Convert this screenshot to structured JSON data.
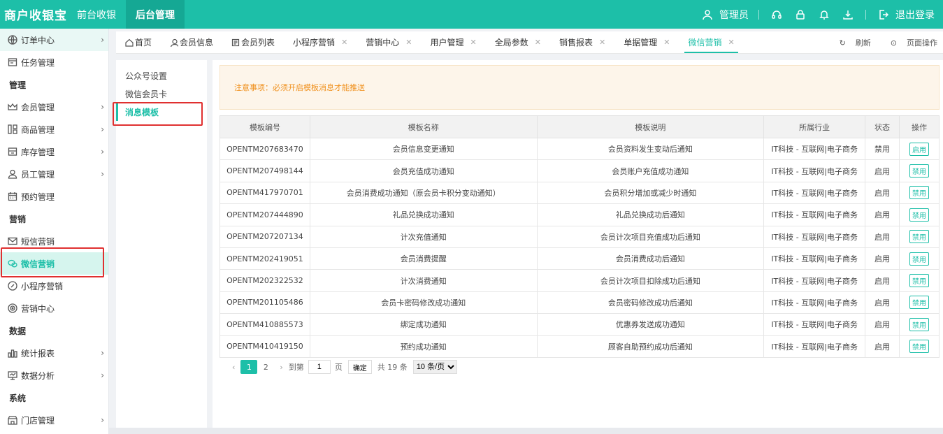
{
  "app": {
    "logo": "商户收银宝",
    "nav": [
      {
        "label": "前台收银",
        "active": false
      },
      {
        "label": "后台管理",
        "active": true
      }
    ],
    "user": "管理员",
    "logout": "退出登录"
  },
  "sidebar": {
    "items": [
      {
        "type": "item",
        "label": "订单中心",
        "icon": "globe-icon",
        "chevron": true,
        "state": "first"
      },
      {
        "type": "item",
        "label": "任务管理",
        "icon": "task-icon",
        "chevron": false
      },
      {
        "type": "group",
        "label": "管理"
      },
      {
        "type": "item",
        "label": "会员管理",
        "icon": "crown-icon",
        "chevron": true
      },
      {
        "type": "item",
        "label": "商品管理",
        "icon": "grid-icon",
        "chevron": true
      },
      {
        "type": "item",
        "label": "库存管理",
        "icon": "box-icon",
        "chevron": true
      },
      {
        "type": "item",
        "label": "员工管理",
        "icon": "user-icon",
        "chevron": true
      },
      {
        "type": "item",
        "label": "预约管理",
        "icon": "calendar-icon",
        "chevron": false
      },
      {
        "type": "group",
        "label": "营销"
      },
      {
        "type": "item",
        "label": "短信营销",
        "icon": "mail-icon",
        "chevron": false
      },
      {
        "type": "item",
        "label": "微信营销",
        "icon": "wechat-icon",
        "chevron": false,
        "state": "active"
      },
      {
        "type": "item",
        "label": "小程序营销",
        "icon": "link-icon",
        "chevron": false
      },
      {
        "type": "item",
        "label": "营销中心",
        "icon": "target-icon",
        "chevron": false
      },
      {
        "type": "group",
        "label": "数据"
      },
      {
        "type": "item",
        "label": "统计报表",
        "icon": "chart-icon",
        "chevron": true
      },
      {
        "type": "item",
        "label": "数据分析",
        "icon": "monitor-icon",
        "chevron": true
      },
      {
        "type": "group",
        "label": "系统"
      },
      {
        "type": "item",
        "label": "门店管理",
        "icon": "store-icon",
        "chevron": true
      }
    ]
  },
  "tabs": {
    "items": [
      {
        "label": "首页",
        "icon": "home-icon",
        "closable": false
      },
      {
        "label": "会员信息",
        "icon": "user-icon",
        "closable": false
      },
      {
        "label": "会员列表",
        "icon": "list-icon",
        "closable": false
      },
      {
        "label": "小程序营销",
        "closable": true
      },
      {
        "label": "营销中心",
        "closable": true
      },
      {
        "label": "用户管理",
        "closable": true
      },
      {
        "label": "全局参数",
        "closable": true
      },
      {
        "label": "销售报表",
        "closable": true
      },
      {
        "label": "单据管理",
        "closable": true
      },
      {
        "label": "微信营销",
        "closable": true,
        "active": true
      }
    ],
    "refresh": "刷新",
    "page_ops": "页面操作",
    "close_glyph": "✕"
  },
  "submenu": {
    "items": [
      {
        "label": "公众号设置"
      },
      {
        "label": "微信会员卡"
      },
      {
        "label": "消息模板",
        "active": true
      }
    ]
  },
  "notice": "注意事项：必须开启模板消息才能推送",
  "table": {
    "headers": [
      "模板编号",
      "模板名称",
      "模板说明",
      "所属行业",
      "状态",
      "操作"
    ],
    "rows": [
      {
        "code": "OPENTM207683470",
        "name": "会员信息变更通知",
        "desc": "会员资料发生变动后通知",
        "industry": "IT科技 - 互联网|电子商务",
        "status": "禁用",
        "action": "启用"
      },
      {
        "code": "OPENTM207498144",
        "name": "会员充值成功通知",
        "desc": "会员账户充值成功通知",
        "industry": "IT科技 - 互联网|电子商务",
        "status": "启用",
        "action": "禁用"
      },
      {
        "code": "OPENTM417970701",
        "name": "会员消费成功通知（原会员卡积分变动通知）",
        "desc": "会员积分增加或减少时通知",
        "industry": "IT科技 - 互联网|电子商务",
        "status": "启用",
        "action": "禁用"
      },
      {
        "code": "OPENTM207444890",
        "name": "礼品兑换成功通知",
        "desc": "礼品兑换成功后通知",
        "industry": "IT科技 - 互联网|电子商务",
        "status": "启用",
        "action": "禁用"
      },
      {
        "code": "OPENTM207207134",
        "name": "计次充值通知",
        "desc": "会员计次项目充值成功后通知",
        "industry": "IT科技 - 互联网|电子商务",
        "status": "启用",
        "action": "禁用"
      },
      {
        "code": "OPENTM202419051",
        "name": "会员消费提醒",
        "desc": "会员消费成功后通知",
        "industry": "IT科技 - 互联网|电子商务",
        "status": "启用",
        "action": "禁用"
      },
      {
        "code": "OPENTM202322532",
        "name": "计次消费通知",
        "desc": "会员计次项目扣除成功后通知",
        "industry": "IT科技 - 互联网|电子商务",
        "status": "启用",
        "action": "禁用"
      },
      {
        "code": "OPENTM201105486",
        "name": "会员卡密码修改成功通知",
        "desc": "会员密码修改成功后通知",
        "industry": "IT科技 - 互联网|电子商务",
        "status": "启用",
        "action": "禁用"
      },
      {
        "code": "OPENTM410885573",
        "name": "绑定成功通知",
        "desc": "优惠券发送成功通知",
        "industry": "IT科技 - 互联网|电子商务",
        "status": "启用",
        "action": "禁用"
      },
      {
        "code": "OPENTM410419150",
        "name": "预约成功通知",
        "desc": "顾客自助预约成功后通知",
        "industry": "IT科技 - 互联网|电子商务",
        "status": "启用",
        "action": "禁用"
      }
    ]
  },
  "pager": {
    "pages": [
      "1",
      "2"
    ],
    "current": "1",
    "prev": "‹",
    "next": "›",
    "goto_label": "到第",
    "goto_value": "1",
    "page_unit": "页",
    "confirm": "确定",
    "total": "共 19 条",
    "page_size": "10 条/页"
  },
  "colors": {
    "accent": "#1dbfa8",
    "notice_text": "#f0901c",
    "highlight_border": "#e03030"
  }
}
